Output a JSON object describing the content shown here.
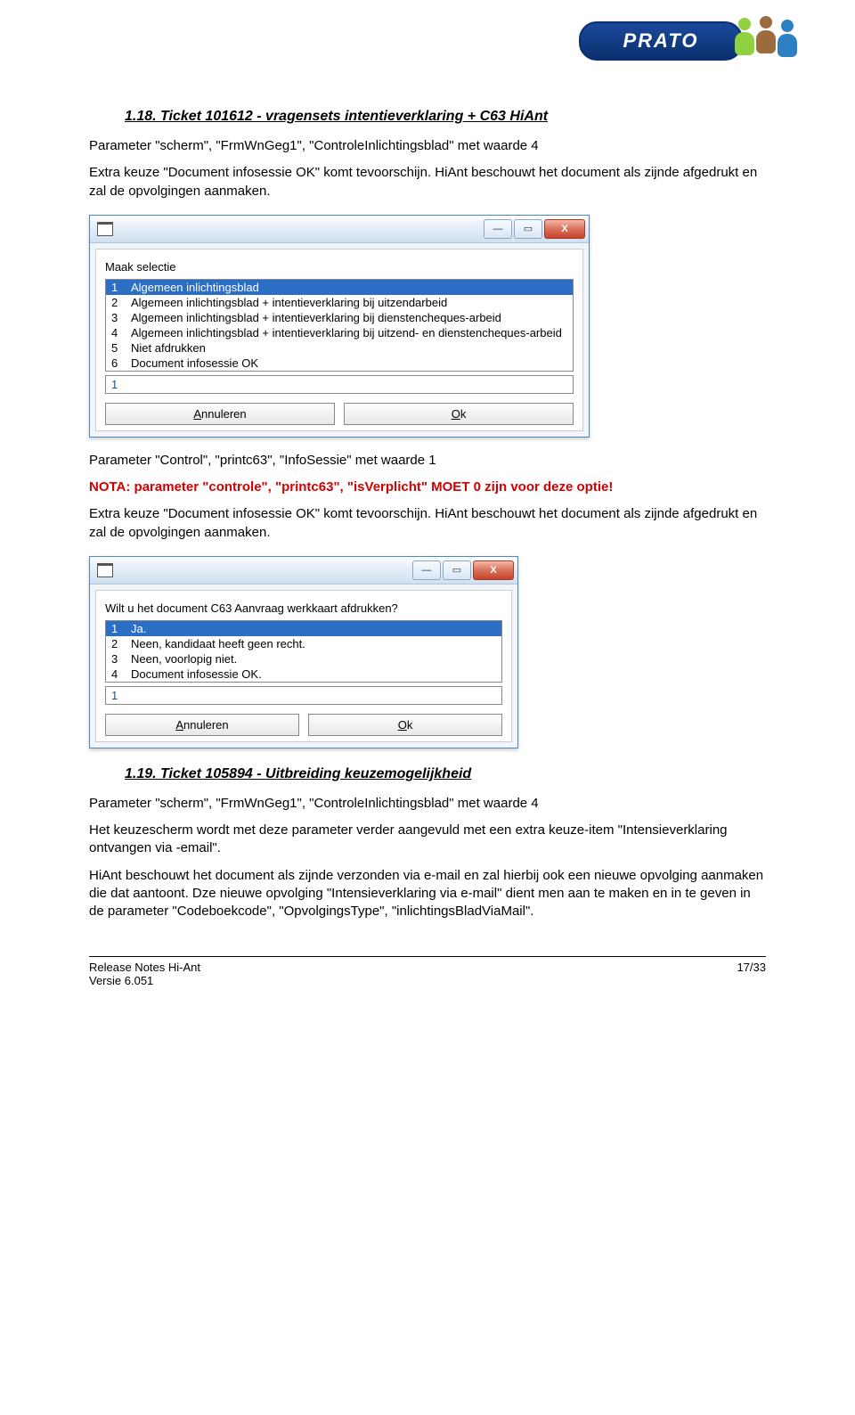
{
  "logo": {
    "text": "PRATO"
  },
  "section118": {
    "heading": "1.18.   Ticket 101612 - vragensets intentieverklaring + C63 HiAnt",
    "p1": "Parameter \"scherm\", \"FrmWnGeg1\", \"ControleInlichtingsblad\" met waarde 4",
    "p2": "Extra keuze \"Document infosessie OK\" komt tevoorschijn. HiAnt beschouwt het document als zijnde afgedrukt en zal de opvolgingen aanmaken.",
    "p3": "Parameter \"Control\", \"printc63\", \"InfoSessie\" met waarde 1",
    "nota": "NOTA: parameter \"controle\", \"printc63\", \"isVerplicht\" MOET 0 zijn voor deze optie!",
    "p4": "Extra keuze \"Document infosessie OK\" komt tevoorschijn. HiAnt beschouwt het document als zijnde afgedrukt en zal de opvolgingen aanmaken."
  },
  "dialog1": {
    "label": "Maak selectie",
    "rows": [
      {
        "n": "1",
        "t": "Algemeen inlichtingsblad"
      },
      {
        "n": "2",
        "t": "Algemeen inlichtingsblad + intentieverklaring bij uitzendarbeid"
      },
      {
        "n": "3",
        "t": "Algemeen inlichtingsblad + intentieverklaring bij dienstencheques-arbeid"
      },
      {
        "n": "4",
        "t": "Algemeen inlichtingsblad + intentieverklaring bij uitzend- en dienstencheques-arbeid"
      },
      {
        "n": "5",
        "t": "Niet afdrukken"
      },
      {
        "n": "6",
        "t": "Document infosessie OK"
      }
    ],
    "input": "1",
    "cancel": "Annuleren",
    "ok": "Ok"
  },
  "dialog2": {
    "label": "Wilt u het document C63 Aanvraag werkkaart afdrukken?",
    "rows": [
      {
        "n": "1",
        "t": "Ja."
      },
      {
        "n": "2",
        "t": "Neen, kandidaat heeft geen recht."
      },
      {
        "n": "3",
        "t": "Neen, voorlopig niet."
      },
      {
        "n": "4",
        "t": "Document infosessie OK."
      }
    ],
    "input": "1",
    "cancel": "Annuleren",
    "ok": "Ok"
  },
  "section119": {
    "heading": "1.19.   Ticket 105894 - Uitbreiding keuzemogelijkheid",
    "p1": "Parameter \"scherm\", \"FrmWnGeg1\", \"ControleInlichtingsblad\" met waarde 4",
    "p2": "Het keuzescherm wordt met deze parameter verder aangevuld met een extra keuze-item \"Intensieverklaring ontvangen via -email\".",
    "p3": "HiAnt beschouwt het document als zijnde verzonden via e-mail en zal hierbij ook een nieuwe opvolging aanmaken die dat aantoont. Dze nieuwe opvolging \"Intensieverklaring via e-mail\" dient men aan te maken en in te geven in de parameter \"Codeboekcode\", \"OpvolgingsType\", \"inlichtingsBladViaMail\"."
  },
  "footer": {
    "left1": "Release Notes Hi-Ant",
    "left2": "Versie 6.051",
    "right": "17/33"
  },
  "win": {
    "min": "—",
    "max": "▭",
    "close": "X"
  }
}
